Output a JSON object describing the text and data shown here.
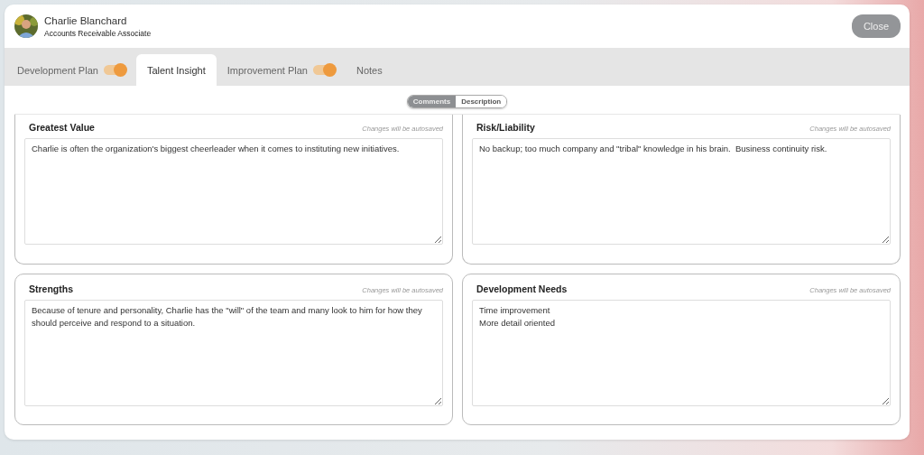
{
  "header": {
    "name": "Charlie Blanchard",
    "role": "Accounts Receivable Associate",
    "close_button": "Close"
  },
  "tabs": [
    {
      "label": "Development Plan",
      "selected": false,
      "kind": "toggle",
      "on": true
    },
    {
      "label": "Talent Insight",
      "selected": true,
      "kind": "plain"
    },
    {
      "label": "Improvement Plan",
      "selected": false,
      "kind": "toggle",
      "on": true
    },
    {
      "label": "Notes",
      "selected": false,
      "kind": "plain"
    }
  ],
  "view_switch": [
    {
      "label": "Comments",
      "selected": true
    },
    {
      "label": "Description",
      "selected": false
    }
  ],
  "cards": [
    {
      "title": "Greatest Value",
      "note": "Changes will be autosaved",
      "value": "Charlie is often the organization's biggest cheerleader when it comes to instituting new initiatives."
    },
    {
      "title": "Risk/Liability",
      "note": "Changes will be autosaved",
      "value": "No backup; too much company and \"tribal\" knowledge in his brain.  Business continuity risk."
    },
    {
      "title": "Strengths",
      "note": "Changes will be autosaved",
      "value": "Because of tenure and personality, Charlie has the \"will\" of the team and many look to him for how they should perceive and respond to a situation."
    },
    {
      "title": "Development Needs",
      "note": "Changes will be autosaved",
      "value": "Time improvement\nMore detail oriented"
    }
  ]
}
